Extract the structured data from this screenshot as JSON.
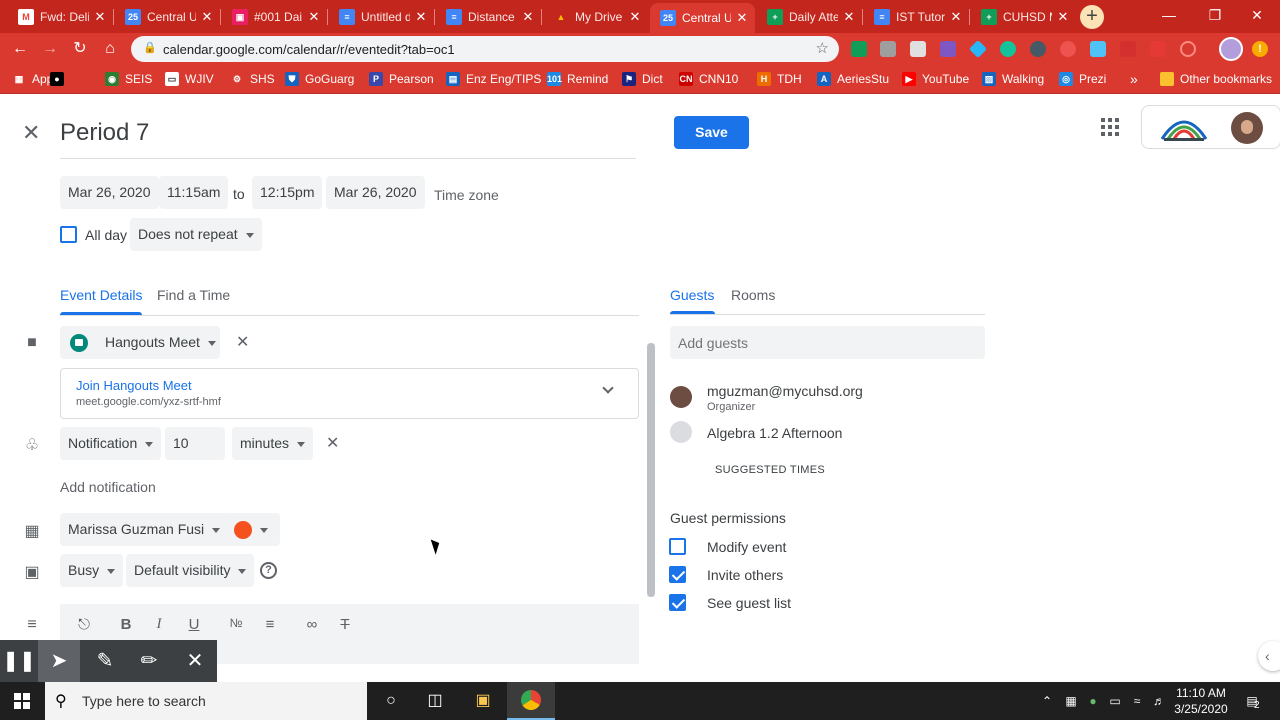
{
  "browser": {
    "tabs": [
      {
        "title": "Fwd: Deli",
        "fav": "M",
        "color": "#ea4335",
        "favbg": "#ffffff"
      },
      {
        "title": "Central U",
        "fav": "25",
        "color": "#fff",
        "favbg": "#4285f4"
      },
      {
        "title": "#001 Dai",
        "fav": "▣",
        "color": "#fff",
        "favbg": "#e91e63"
      },
      {
        "title": "Untitled d",
        "fav": "≡",
        "color": "#fff",
        "favbg": "#4285f4"
      },
      {
        "title": "Distance",
        "fav": "≡",
        "color": "#fff",
        "favbg": "#4285f4"
      },
      {
        "title": "My Drive",
        "fav": "▲",
        "color": "#fbbc04",
        "favbg": "transparent"
      },
      {
        "title": "Central U",
        "fav": "25",
        "color": "#fff",
        "favbg": "#4285f4"
      },
      {
        "title": "Daily Atte",
        "fav": "+",
        "color": "#fff",
        "favbg": "#0f9d58"
      },
      {
        "title": "IST Tutor",
        "fav": "≡",
        "color": "#fff",
        "favbg": "#4285f4"
      },
      {
        "title": "CUHSD M",
        "fav": "+",
        "color": "#fff",
        "favbg": "#0f9d58"
      }
    ],
    "url": "calendar.google.com/calendar/r/eventedit?tab=oc1",
    "bookmarks": [
      {
        "label": "Apps",
        "icon": "▦",
        "bg": "#d9392f"
      },
      {
        "label": "",
        "icon": "●",
        "bg": "#000000"
      },
      {
        "label": "SEIS",
        "icon": "◉",
        "bg": "#2e7d32"
      },
      {
        "label": "WJIV",
        "icon": "▭",
        "bg": "#ffffff"
      },
      {
        "label": "SHS",
        "icon": "⚙",
        "bg": "#d9392f"
      },
      {
        "label": "GoGuarg",
        "icon": "⛊",
        "bg": "#1565c0"
      },
      {
        "label": "Pearson",
        "icon": "P",
        "bg": "#3949ab"
      },
      {
        "label": "Enz Eng/TIPS",
        "icon": "▤",
        "bg": "#1565c0"
      },
      {
        "label": "Remind",
        "icon": "101",
        "bg": "#1e88e5"
      },
      {
        "label": "Dict",
        "icon": "⚑",
        "bg": "#1a237e"
      },
      {
        "label": "CNN10",
        "icon": "CN",
        "bg": "#cc0000"
      },
      {
        "label": "TDH",
        "icon": "H",
        "bg": "#ef6c00"
      },
      {
        "label": "AeriesStu",
        "icon": "A",
        "bg": "#1565c0"
      },
      {
        "label": "YouTube",
        "icon": "▶",
        "bg": "#ff0000"
      },
      {
        "label": "Walking",
        "icon": "▨",
        "bg": "#1565c0"
      },
      {
        "label": "Prezi",
        "icon": "◎",
        "bg": "#1e88e5"
      }
    ],
    "more_bookmarks": "»",
    "other_bookmarks": "Other bookmarks"
  },
  "event": {
    "title": "Period 7",
    "save_label": "Save",
    "start_date": "Mar 26, 2020",
    "start_time": "11:15am",
    "to_label": "to",
    "end_time": "12:15pm",
    "end_date": "Mar 26, 2020",
    "timezone_label": "Time zone",
    "allday_label": "All day",
    "repeat": "Does not repeat",
    "tabs": {
      "details": "Event Details",
      "find_time": "Find a Time"
    },
    "conferencing": {
      "provider": "Hangouts Meet",
      "join_label": "Join Hangouts Meet",
      "link": "meet.google.com/yxz-srtf-hmf"
    },
    "notification": {
      "type": "Notification",
      "value": "10",
      "unit": "minutes"
    },
    "add_notification": "Add notification",
    "calendar_owner": "Marissa Guzman Fusi",
    "event_color": "#f4511e",
    "availability": "Busy",
    "visibility": "Default visibility"
  },
  "guests_panel": {
    "tabs": {
      "guests": "Guests",
      "rooms": "Rooms"
    },
    "add_placeholder": "Add guests",
    "guests": [
      {
        "name": "mguzman@mycuhsd.org",
        "role": "Organizer"
      },
      {
        "name": "Algebra 1.2 Afternoon",
        "role": ""
      }
    ],
    "suggested_times": "SUGGESTED TIMES",
    "permissions_title": "Guest permissions",
    "permissions": [
      {
        "label": "Modify event",
        "checked": false
      },
      {
        "label": "Invite others",
        "checked": true
      },
      {
        "label": "See guest list",
        "checked": true
      }
    ]
  },
  "taskbar": {
    "search_placeholder": "Type here to search",
    "time": "11:10 AM",
    "date": "3/25/2020",
    "notification_count": "2"
  }
}
